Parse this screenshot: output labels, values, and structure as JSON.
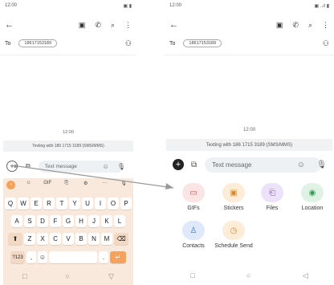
{
  "left": {
    "status_time": "12:00",
    "status_icons": "▣ ▮",
    "to_label": "To",
    "recipient": "18617153189",
    "timestamp": "12:00",
    "banner": "Texting with 186 1715 3189 (SMS/MMS)",
    "input_placeholder": "Text message",
    "kb_tools": [
      "‹",
      "☺",
      "GIF",
      "⎘",
      "⚙",
      "···",
      "🎙"
    ],
    "row1": [
      "Q",
      "W",
      "E",
      "R",
      "T",
      "Y",
      "U",
      "I",
      "O",
      "P"
    ],
    "row2": [
      "A",
      "S",
      "D",
      "F",
      "G",
      "H",
      "J",
      "K",
      "L"
    ],
    "row3": [
      "Z",
      "X",
      "C",
      "V",
      "B",
      "N",
      "M"
    ],
    "key_123": "?123",
    "key_comma": ",",
    "key_period": ".",
    "nav": [
      "□",
      "○",
      "▽"
    ]
  },
  "right": {
    "status_time": "12:00",
    "status_icons": "▣ ..ıl ▮",
    "to_label": "To",
    "recipient": "18617153189",
    "timestamp": "12:00",
    "banner": "Texting with 186 1715 3189 (SMS/MMS)",
    "input_placeholder": "Text message",
    "attachments": [
      {
        "label": "GIFs",
        "icon": "gif-icon",
        "glyph": "▭",
        "color": "#fbe4e4",
        "fg": "#d44"
      },
      {
        "label": "Stickers",
        "icon": "sticker-icon",
        "glyph": "▣",
        "color": "#fdecd8",
        "fg": "#d98a2b"
      },
      {
        "label": "Files",
        "icon": "paperclip-icon",
        "glyph": "⎗",
        "color": "#ece3fb",
        "fg": "#8a55d6"
      },
      {
        "label": "Location",
        "icon": "location-pin-icon",
        "glyph": "◉",
        "color": "#e0f2e4",
        "fg": "#2f9a4f"
      },
      {
        "label": "Contacts",
        "icon": "contacts-icon",
        "glyph": "♙",
        "color": "#dfe9fb",
        "fg": "#3a6fd0"
      },
      {
        "label": "Schedule Send",
        "icon": "clock-icon",
        "glyph": "◷",
        "color": "#fdecd8",
        "fg": "#d98a2b"
      }
    ],
    "nav": [
      "□",
      "○",
      "◁"
    ]
  },
  "colors": {
    "accent": "#f5a35c",
    "arrow": "#999999"
  }
}
